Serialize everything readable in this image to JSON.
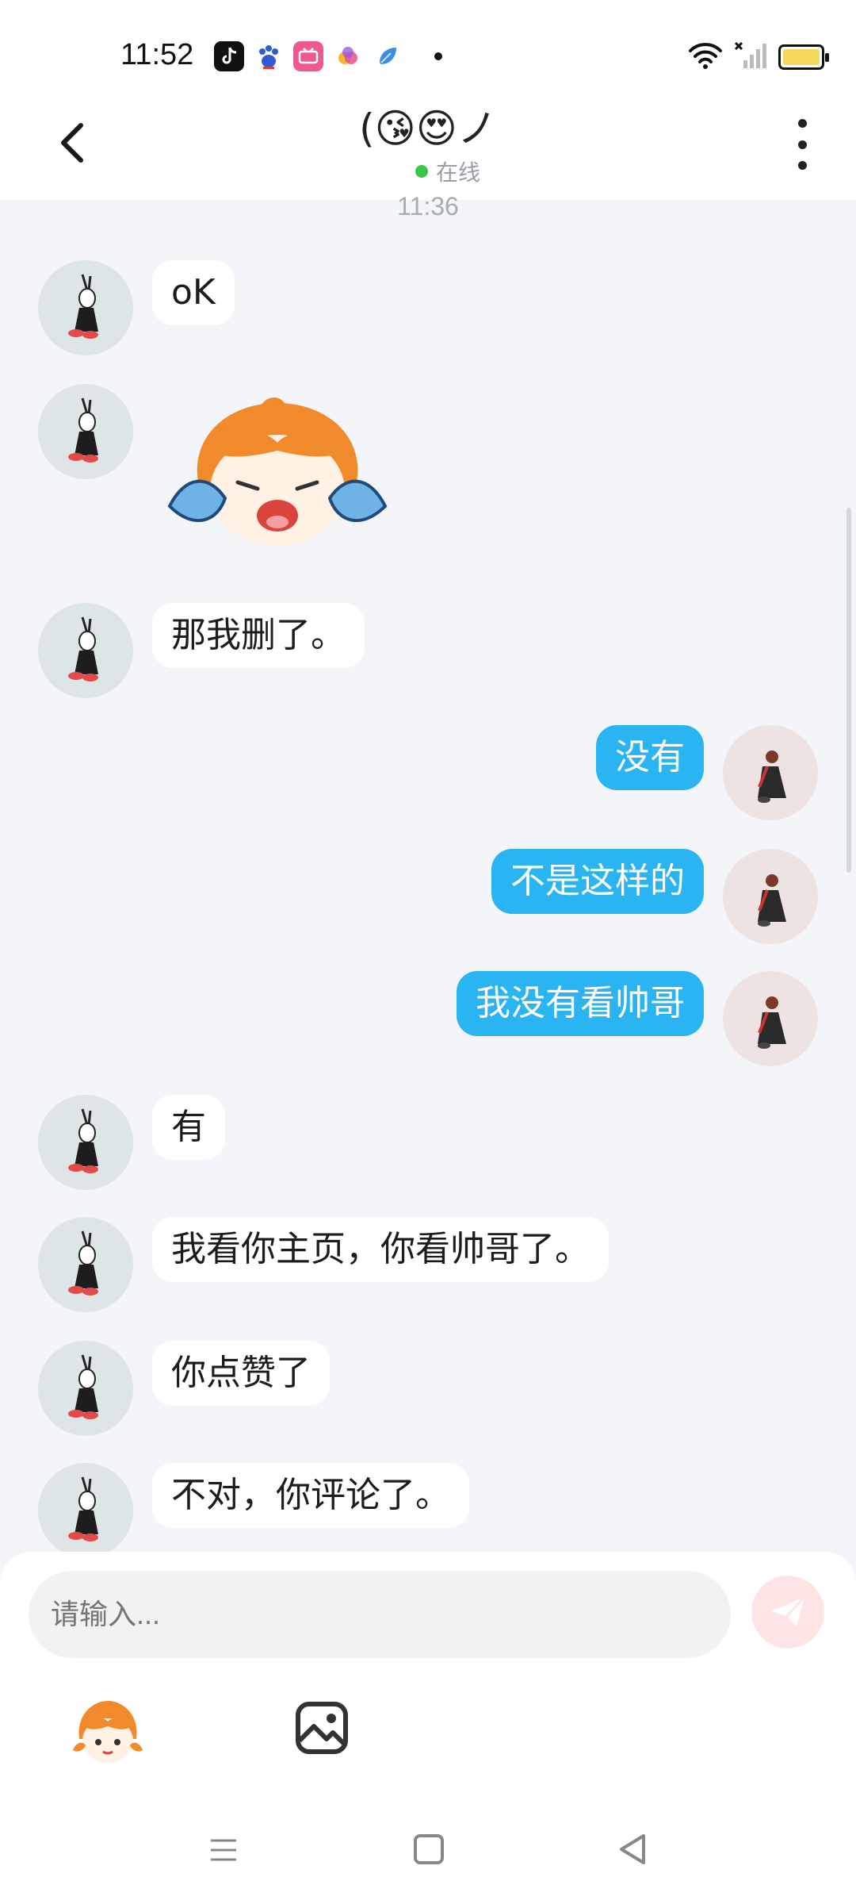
{
  "status_bar": {
    "time": "11:52",
    "app_icons": [
      "tiktok-icon",
      "baidu-icon",
      "bilibili-icon",
      "colorful-app-icon",
      "blue-app-icon"
    ],
    "system_icons": [
      "wifi-icon",
      "signal-icon",
      "battery-icon"
    ]
  },
  "header": {
    "title": "(😘😍ノ",
    "presence": "在线"
  },
  "chat": {
    "timestamp": "11:36",
    "messages": [
      {
        "side": "in",
        "text": "oK"
      },
      {
        "side": "in",
        "sticker": "crying-girl-sticker"
      },
      {
        "side": "in",
        "text": "那我删了。"
      },
      {
        "side": "out",
        "text": "没有"
      },
      {
        "side": "out",
        "text": "不是这样的"
      },
      {
        "side": "out",
        "text": "我没有看帅哥"
      },
      {
        "side": "in",
        "text": "有"
      },
      {
        "side": "in",
        "text": "我看你主页，你看帅哥了。"
      },
      {
        "side": "in",
        "text": "你点赞了"
      },
      {
        "side": "in",
        "text": "不对，你评论了。"
      }
    ]
  },
  "composer": {
    "placeholder": "请输入..."
  },
  "colors": {
    "outgoing_bubble": "#2ab4f1",
    "incoming_bubble": "#ffffff",
    "background": "#f3f5f8",
    "send_button": "#fde5e5",
    "online_dot": "#35c84a"
  }
}
